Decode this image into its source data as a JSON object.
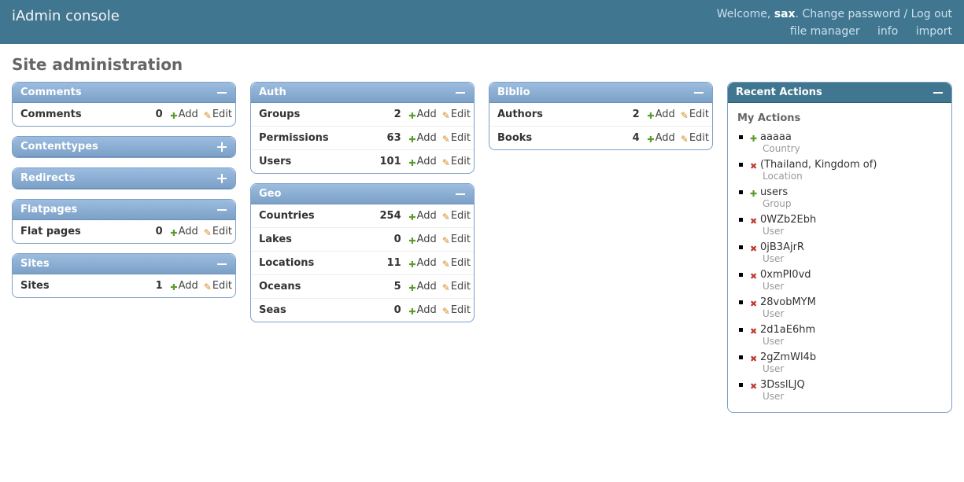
{
  "header": {
    "title": "iAdmin console",
    "welcome_prefix": "Welcome, ",
    "username": "sax",
    "change_password": "Change password",
    "logout": "Log out",
    "nav": {
      "file_manager": "file manager",
      "info": "info",
      "import": "import"
    }
  },
  "page_title": "Site administration",
  "labels": {
    "add": "Add",
    "edit": "Edit"
  },
  "cols": [
    [
      {
        "title": "Comments",
        "collapsed": false,
        "models": [
          {
            "name": "Comments",
            "count": 0
          }
        ]
      },
      {
        "title": "Contenttypes",
        "collapsed": true,
        "models": []
      },
      {
        "title": "Redirects",
        "collapsed": true,
        "models": []
      },
      {
        "title": "Flatpages",
        "collapsed": false,
        "models": [
          {
            "name": "Flat pages",
            "count": 0
          }
        ]
      },
      {
        "title": "Sites",
        "collapsed": false,
        "models": [
          {
            "name": "Sites",
            "count": 1
          }
        ]
      }
    ],
    [
      {
        "title": "Auth",
        "collapsed": false,
        "models": [
          {
            "name": "Groups",
            "count": 2
          },
          {
            "name": "Permissions",
            "count": 63
          },
          {
            "name": "Users",
            "count": 101
          }
        ]
      },
      {
        "title": "Geo",
        "collapsed": false,
        "models": [
          {
            "name": "Countries",
            "count": 254
          },
          {
            "name": "Lakes",
            "count": 0
          },
          {
            "name": "Locations",
            "count": 11
          },
          {
            "name": "Oceans",
            "count": 5
          },
          {
            "name": "Seas",
            "count": 0
          }
        ]
      }
    ],
    [
      {
        "title": "Biblio",
        "collapsed": false,
        "models": [
          {
            "name": "Authors",
            "count": 2
          },
          {
            "name": "Books",
            "count": 4
          }
        ]
      }
    ]
  ],
  "recent": {
    "title": "Recent Actions",
    "subtitle": "My Actions",
    "items": [
      {
        "action": "add",
        "text": "aaaaa",
        "type": "Country"
      },
      {
        "action": "delete",
        "text": "(Thailand, Kingdom of)",
        "type": "Location"
      },
      {
        "action": "add",
        "text": "users",
        "type": "Group"
      },
      {
        "action": "delete",
        "text": "0WZb2Ebh",
        "type": "User"
      },
      {
        "action": "delete",
        "text": "0jB3AjrR",
        "type": "User"
      },
      {
        "action": "delete",
        "text": "0xmPI0vd",
        "type": "User"
      },
      {
        "action": "delete",
        "text": "28vobMYM",
        "type": "User"
      },
      {
        "action": "delete",
        "text": "2d1aE6hm",
        "type": "User"
      },
      {
        "action": "delete",
        "text": "2gZmWl4b",
        "type": "User"
      },
      {
        "action": "delete",
        "text": "3DsslLJQ",
        "type": "User"
      }
    ]
  }
}
